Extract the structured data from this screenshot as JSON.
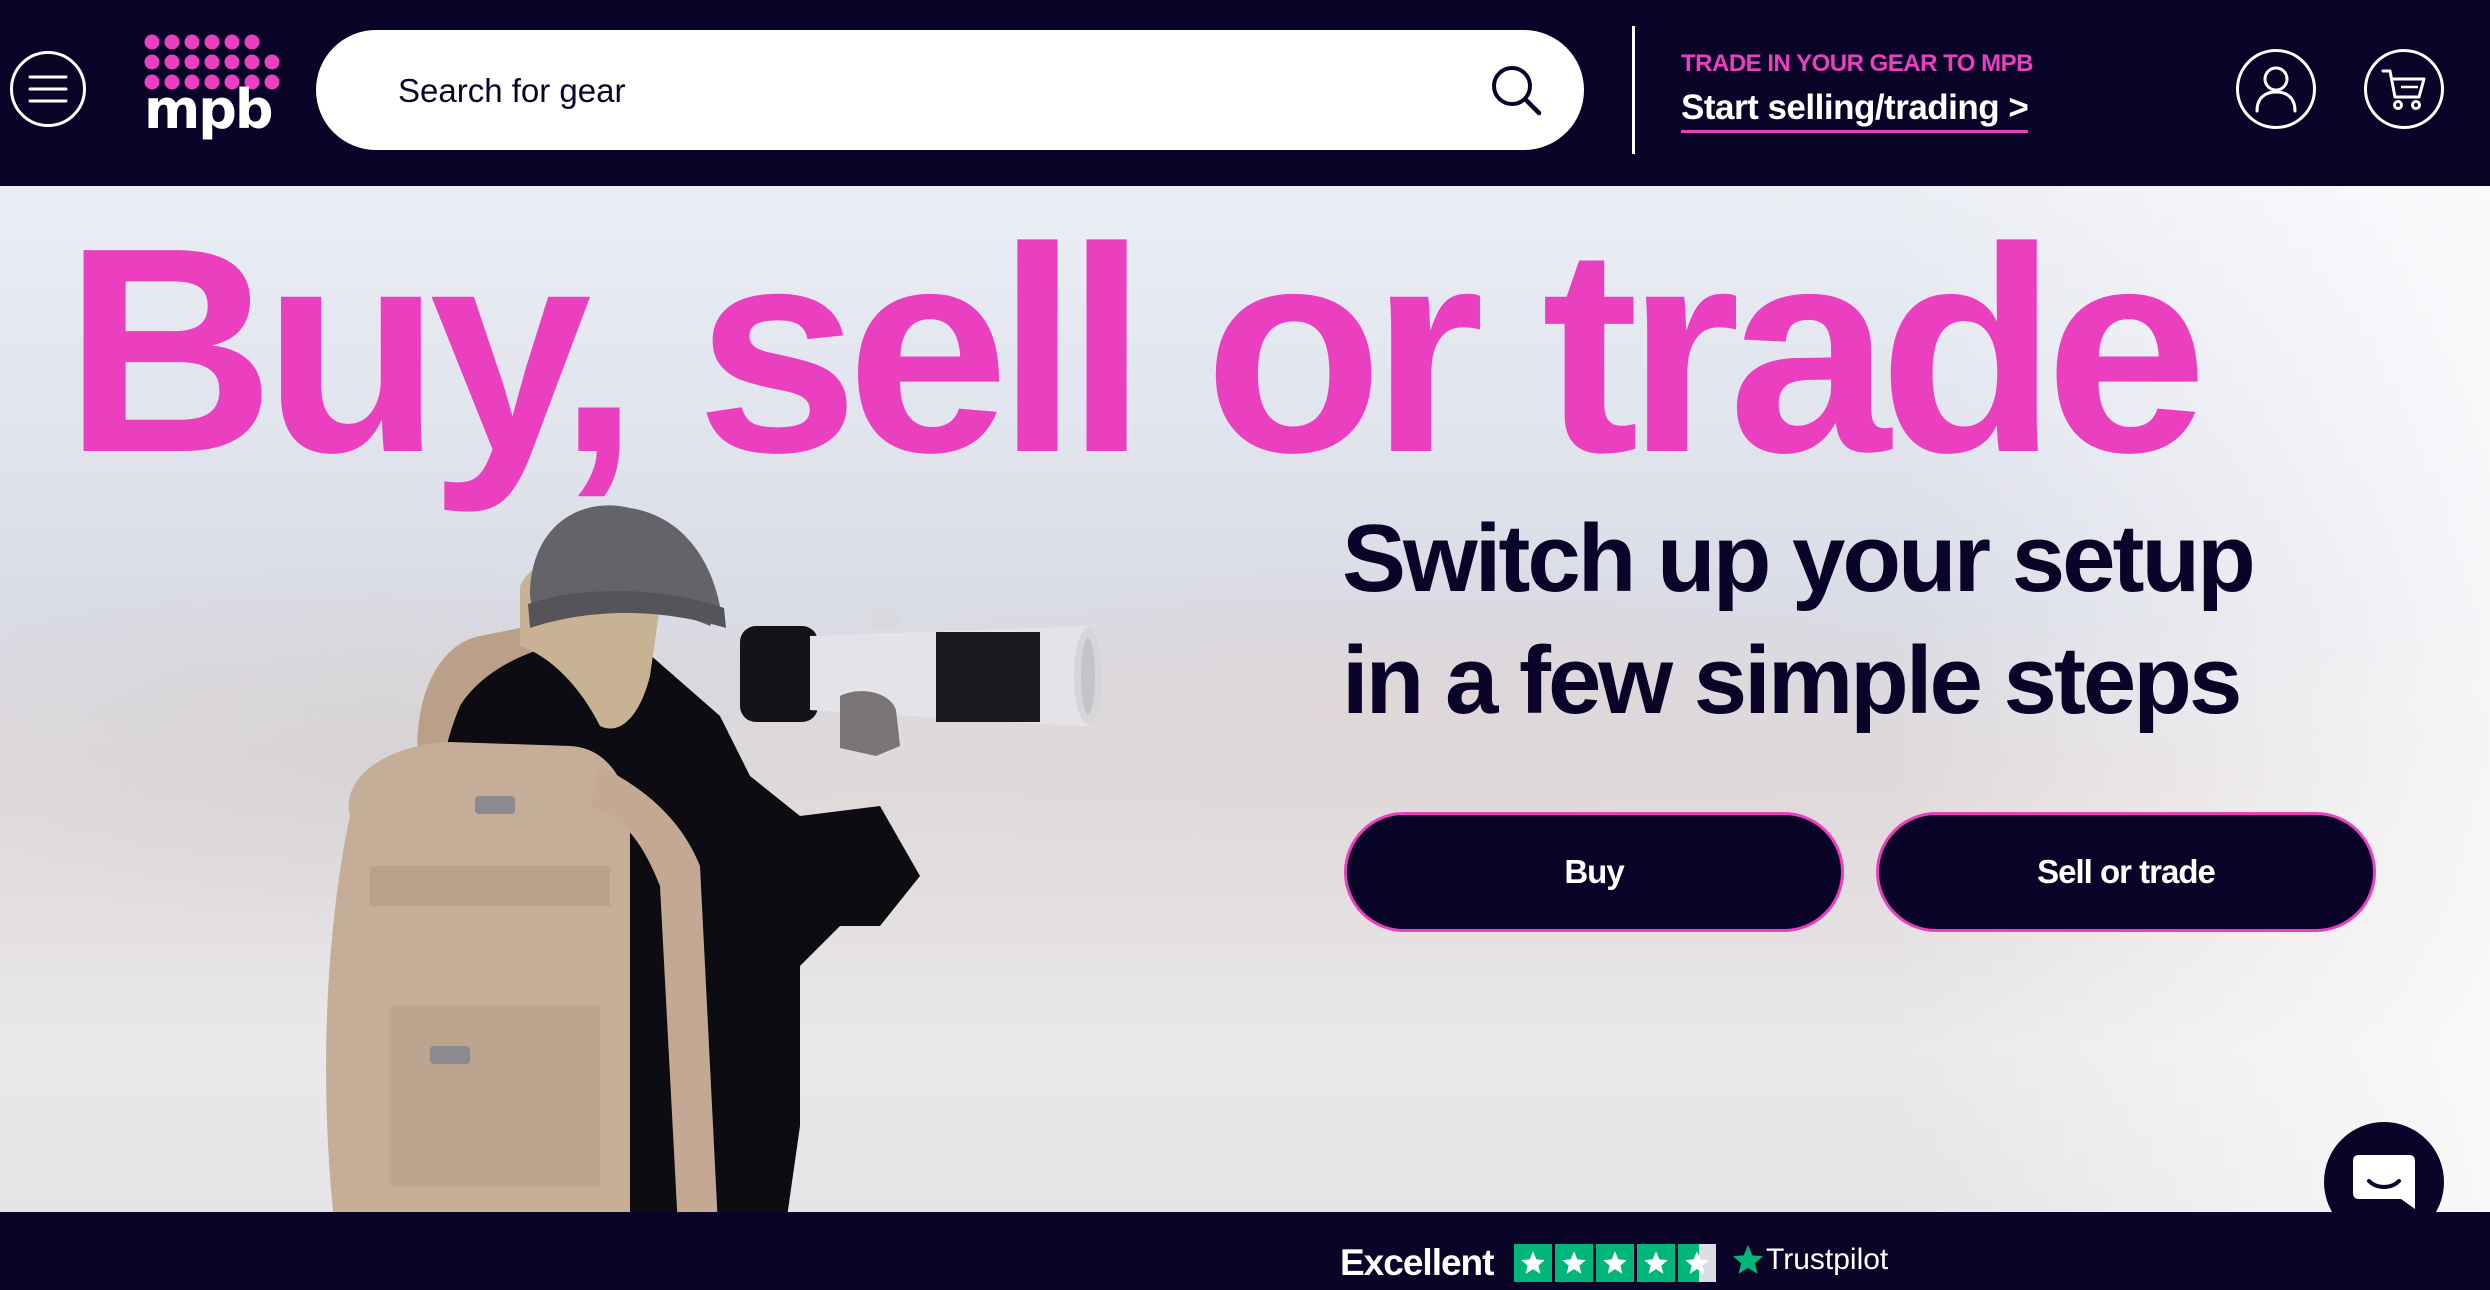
{
  "header": {
    "menu_icon": "hamburger-menu-icon",
    "logo_text": "mpb",
    "search_placeholder": "Search for gear",
    "search_icon": "search-icon",
    "trade_kicker": "TRADE IN YOUR GEAR TO MPB",
    "trade_link": "Start selling/trading >",
    "account_icon": "user-account-icon",
    "cart_icon": "shopping-cart-icon"
  },
  "hero": {
    "headline": "Buy, sell or trade",
    "subhead_line1": "Switch up your setup",
    "subhead_line2": "in a few simple steps",
    "buy_label": "Buy",
    "sell_label": "Sell or trade",
    "image": "photographer-with-telephoto-camera"
  },
  "trust": {
    "rating_label": "Excellent",
    "stars": 4.5,
    "brand": "Trustpilot"
  },
  "chat_icon": "chat-icon",
  "colors": {
    "navy": "#0a0528",
    "magenta": "#ea3fbf",
    "trustpilot_green": "#00b67a"
  }
}
